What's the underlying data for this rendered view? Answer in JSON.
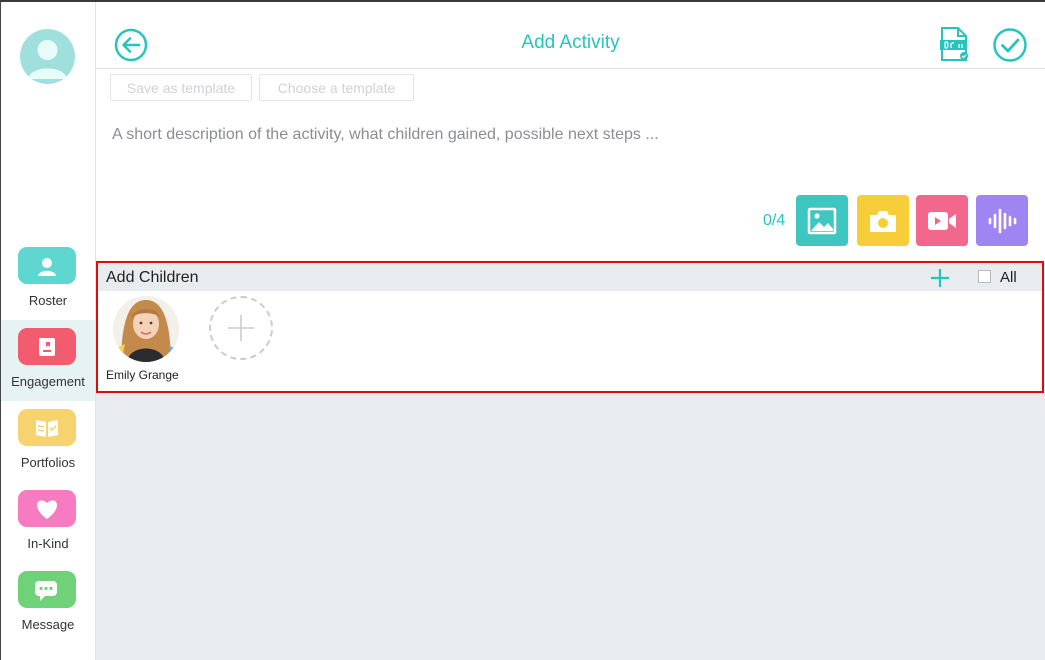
{
  "header": {
    "title": "Add Activity"
  },
  "templates": {
    "save_label": "Save as template",
    "choose_label": "Choose a template"
  },
  "description": {
    "placeholder": "A short description of the activity, what children gained, possible next steps ..."
  },
  "media": {
    "counter": "0/4",
    "buttons": [
      {
        "name": "photo-library-icon",
        "color": "#3ec7c0"
      },
      {
        "name": "camera-icon",
        "color": "#f7cd3a"
      },
      {
        "name": "video-icon",
        "color": "#f2678c"
      },
      {
        "name": "audio-icon",
        "color": "#9e85f2"
      }
    ]
  },
  "sidebar": {
    "items": [
      {
        "label": "Roster",
        "color": "#5fd6cf"
      },
      {
        "label": "Engagement",
        "color": "#f25c6e"
      },
      {
        "label": "Portfolios",
        "color": "#f7d370"
      },
      {
        "label": "In-Kind",
        "color": "#f77bc1"
      },
      {
        "label": "Message",
        "color": "#6fd178"
      }
    ]
  },
  "children_panel": {
    "title": "Add Children",
    "all_label": "All",
    "children": [
      {
        "name": "Emily Grange"
      }
    ]
  },
  "colors": {
    "accent": "#27c4bd",
    "highlight_border": "#e00c0c"
  }
}
